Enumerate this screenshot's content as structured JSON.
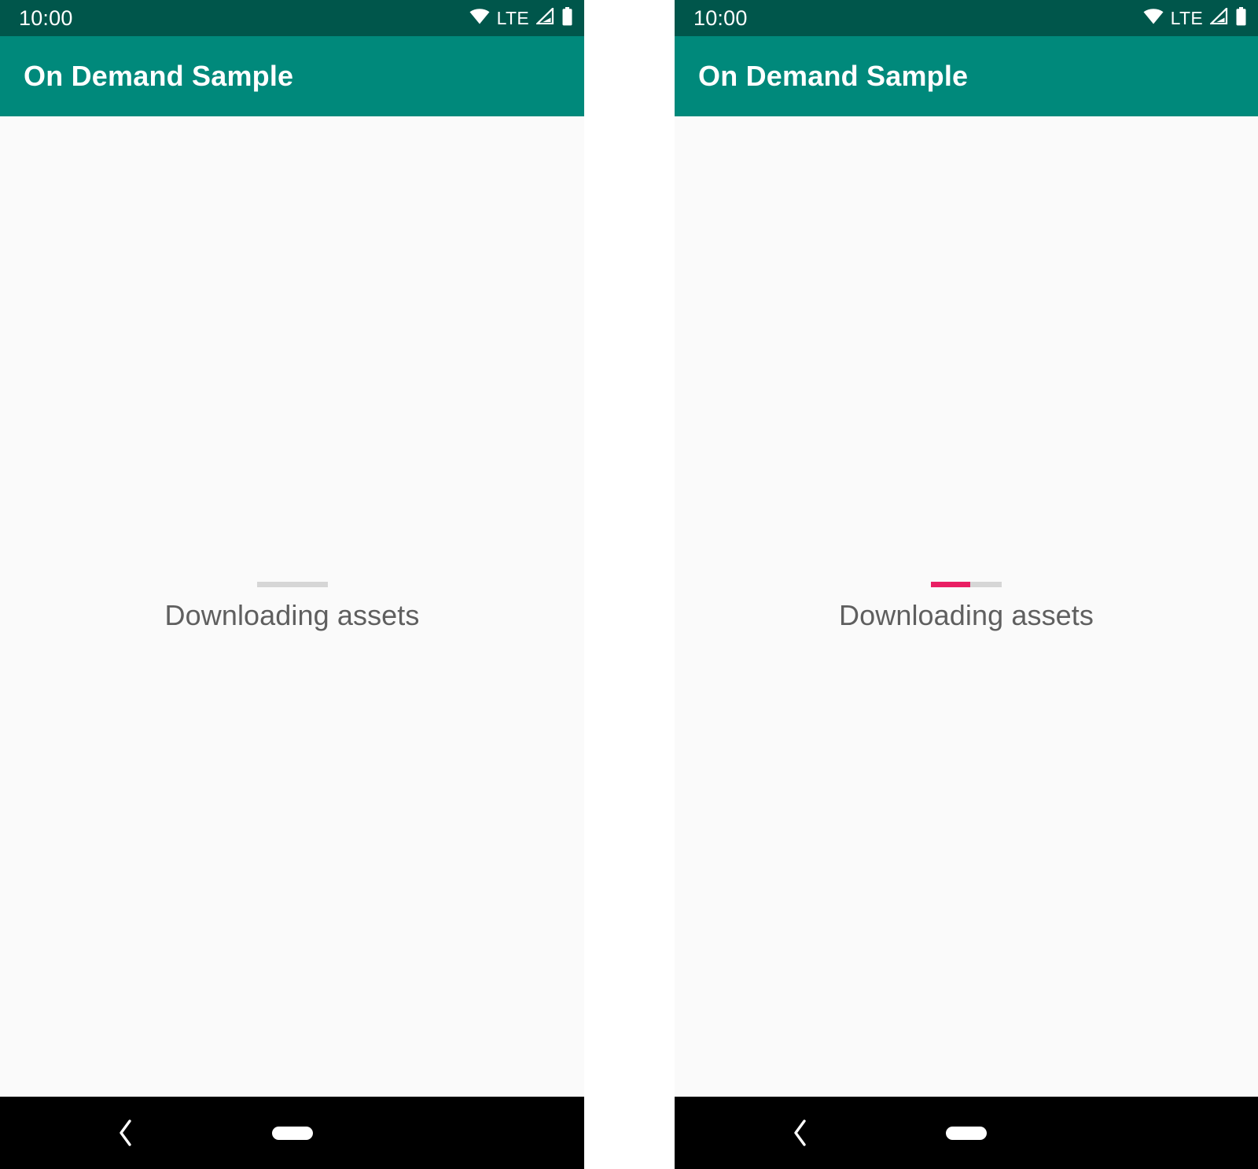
{
  "screens": [
    {
      "id": "screen-left",
      "status_bar": {
        "clock": "10:00",
        "network_label": "LTE",
        "icons": [
          "wifi-icon",
          "lte-label",
          "cellular-signal-icon",
          "battery-icon"
        ]
      },
      "app_bar": {
        "title": "On Demand Sample"
      },
      "body": {
        "progress": {
          "label": "Downloading assets",
          "percent": 0,
          "track_color": "#d6d6d6",
          "fill_color": "#E91E63"
        }
      },
      "nav_bar": {
        "back_label": "‹",
        "home_label": ""
      }
    },
    {
      "id": "screen-right",
      "status_bar": {
        "clock": "10:00",
        "network_label": "LTE",
        "icons": [
          "wifi-icon",
          "lte-label",
          "cellular-signal-icon",
          "battery-icon"
        ]
      },
      "app_bar": {
        "title": "On Demand Sample"
      },
      "body": {
        "progress": {
          "label": "Downloading assets",
          "percent": 55,
          "track_color": "#d6d6d6",
          "fill_color": "#E91E63"
        }
      },
      "nav_bar": {
        "back_label": "‹",
        "home_label": ""
      }
    }
  ],
  "theme": {
    "status_bar_color": "#00564B",
    "app_bar_color": "#00897B",
    "content_bg": "#fafafa",
    "nav_bar_color": "#000000",
    "accent_color": "#E91E63",
    "text_color": "#5f5f5f"
  }
}
